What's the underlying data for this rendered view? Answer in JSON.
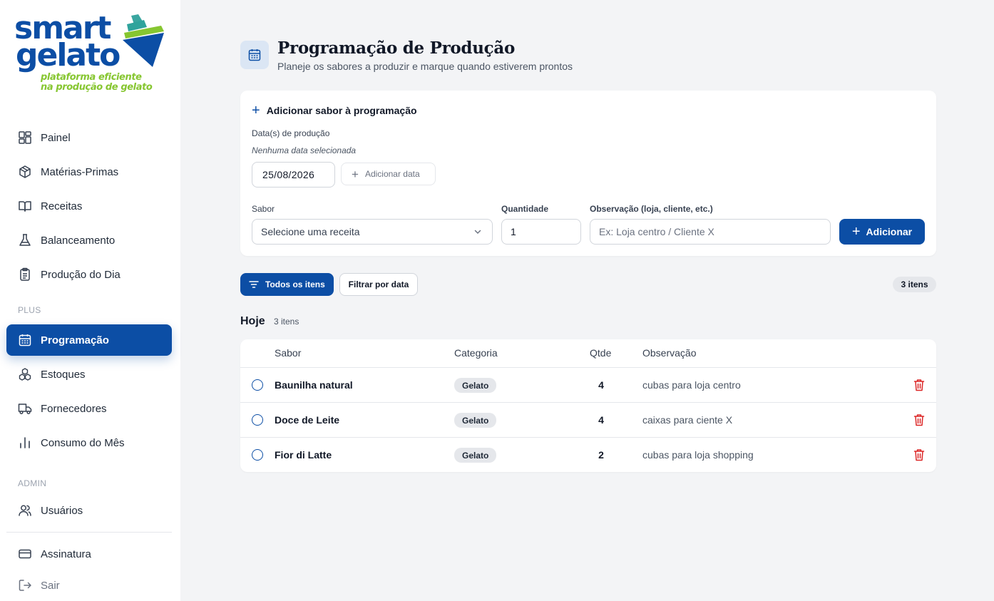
{
  "brand": {
    "word1": "smart",
    "word2": "gelato",
    "tagline1": "plataforma eficiente",
    "tagline2": "na produção de gelato",
    "colors": {
      "primary": "#0c4ea5",
      "accent_green": "#86c630",
      "accent_teal": "#3aa6a0",
      "danger": "#dc2626"
    }
  },
  "sidebar": {
    "items": [
      {
        "label": "Painel",
        "icon": "dashboard-grid-icon"
      },
      {
        "label": "Matérias-Primas",
        "icon": "box-icon"
      },
      {
        "label": "Receitas",
        "icon": "book-icon"
      },
      {
        "label": "Balanceamento",
        "icon": "flask-icon"
      },
      {
        "label": "Produção do Dia",
        "icon": "clipboard-list-icon"
      }
    ],
    "plus_label": "PLUS",
    "plus_items": [
      {
        "label": "Programação",
        "icon": "calendar-icon",
        "active": true
      },
      {
        "label": "Estoques",
        "icon": "boxes-icon"
      },
      {
        "label": "Fornecedores",
        "icon": "truck-icon"
      },
      {
        "label": "Consumo do Mês",
        "icon": "bar-chart-icon"
      }
    ],
    "admin_label": "ADMIN",
    "admin_items": [
      {
        "label": "Usuários",
        "icon": "users-icon"
      }
    ],
    "footer_items": [
      {
        "label": "Assinatura",
        "icon": "credit-card-icon"
      },
      {
        "label": "Sair",
        "icon": "logout-icon"
      }
    ]
  },
  "header": {
    "icon": "calendar-icon",
    "title": "Programação de Produção",
    "subtitle": "Planeje os sabores a produzir e marque quando estiverem prontos"
  },
  "add_form": {
    "title": "Adicionar sabor à programação",
    "dates_label": "Data(s) de produção",
    "dates_hint": "Nenhuma data selecionada",
    "date_value": "25/08/2026",
    "add_date_label": "Adicionar data",
    "flavor_label": "Sabor",
    "flavor_placeholder": "Selecione uma receita",
    "quantity_label": "Quantidade",
    "quantity_value": "1",
    "note_label": "Observação (loja, cliente, etc.)",
    "note_placeholder": "Ex: Loja centro / Cliente X",
    "submit_label": "Adicionar"
  },
  "filters": {
    "all_label": "Todos os itens",
    "by_date_label": "Filtrar por data",
    "total_count": "3 itens"
  },
  "group": {
    "title": "Hoje",
    "count": "3 itens",
    "columns": {
      "flavor": "Sabor",
      "category": "Categoria",
      "qty": "Qtde",
      "note": "Observação"
    },
    "rows": [
      {
        "flavor": "Baunilha natural",
        "category": "Gelato",
        "qty": "4",
        "note": "cubas para loja centro"
      },
      {
        "flavor": "Doce de Leite",
        "category": "Gelato",
        "qty": "4",
        "note": "caixas para ciente X"
      },
      {
        "flavor": "Fior di Latte",
        "category": "Gelato",
        "qty": "2",
        "note": "cubas para loja shopping"
      }
    ]
  }
}
